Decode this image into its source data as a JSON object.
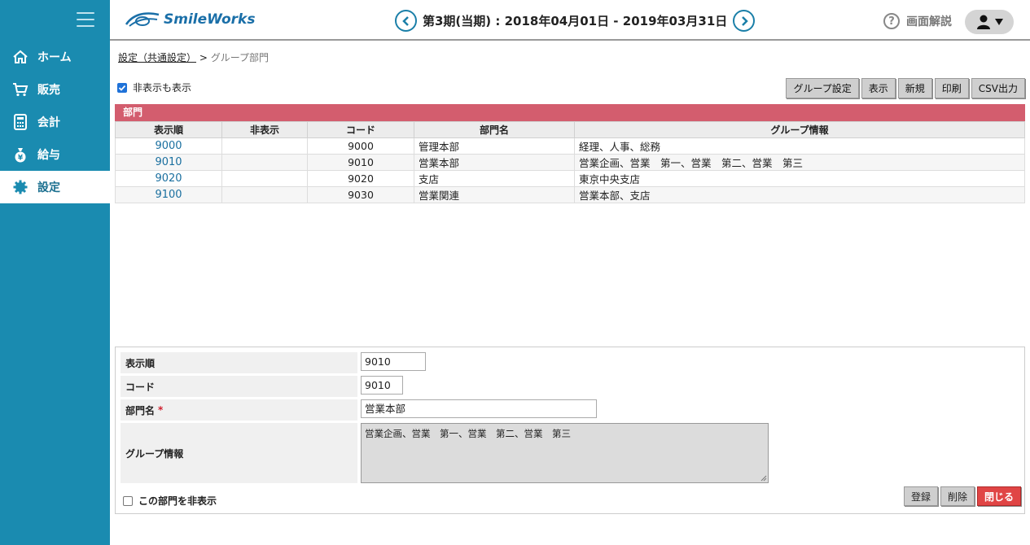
{
  "app": {
    "logo_text": "SmileWorks"
  },
  "header": {
    "period_label": "第3期(当期) : 2018年04月01日 - 2019年03月31日",
    "help_label": "画面解説"
  },
  "sidebar": {
    "items": [
      {
        "label": "ホーム",
        "icon": "home-icon"
      },
      {
        "label": "販売",
        "icon": "cart-icon"
      },
      {
        "label": "会計",
        "icon": "calculator-icon"
      },
      {
        "label": "給与",
        "icon": "money-bag-icon"
      },
      {
        "label": "設定",
        "icon": "gear-icon",
        "active": true
      }
    ]
  },
  "breadcrumb": {
    "parent": "設定（共通設定）",
    "separator": ">",
    "current": "グループ部門"
  },
  "filter": {
    "show_hidden_label": "非表示も表示",
    "checked": true
  },
  "toolbar": {
    "group_settings": "グループ設定",
    "show": "表示",
    "new": "新規",
    "print": "印刷",
    "csv": "CSV出力"
  },
  "section_title": "部門",
  "table": {
    "columns": [
      "表示順",
      "非表示",
      "コード",
      "部門名",
      "グループ情報"
    ],
    "rows": [
      {
        "order": "9000",
        "hidden": "",
        "code": "9000",
        "name": "管理本部",
        "group": "経理、人事、総務"
      },
      {
        "order": "9010",
        "hidden": "",
        "code": "9010",
        "name": "営業本部",
        "group": "営業企画、営業　第一、営業　第二、営業　第三"
      },
      {
        "order": "9020",
        "hidden": "",
        "code": "9020",
        "name": "支店",
        "group": "東京中央支店"
      },
      {
        "order": "9100",
        "hidden": "",
        "code": "9030",
        "name": "営業関連",
        "group": "営業本部、支店"
      }
    ]
  },
  "form": {
    "order_label": "表示順",
    "order_value": "9010",
    "code_label": "コード",
    "code_value": "9010",
    "name_label": "部門名",
    "required_mark": "*",
    "name_value": "営業本部",
    "group_label": "グループ情報",
    "group_value": "営業企画、営業　第一、営業　第二、営業　第三",
    "hide_label": "この部門を非表示",
    "register": "登録",
    "delete": "削除",
    "close": "閉じる"
  },
  "colors": {
    "sidebar": "#1a8bb0",
    "section_bar": "#d35d6e",
    "close_button": "#e04545"
  }
}
